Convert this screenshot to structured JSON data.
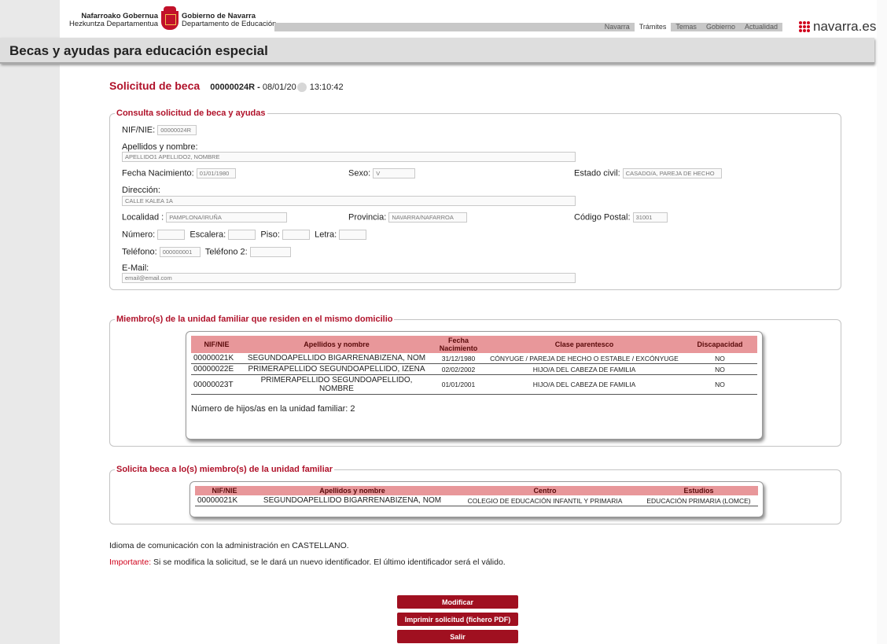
{
  "header": {
    "logo_line1_left": "Nafarroako Gobernua",
    "logo_line2_left": "Hezkuntza Departamentua",
    "logo_line1_right": "Gobierno de Navarra",
    "logo_line2_right": "Departamento de Educación",
    "nav": [
      "Navarra",
      "Trámites",
      "Temas",
      "Gobierno",
      "Actualidad"
    ],
    "nav_active": "Trámites",
    "site_logo": "navarra.es"
  },
  "page_title": "Becas y ayudas para educación especial",
  "solicitud": {
    "label": "Solicitud de beca",
    "id": "00000024R -",
    "date": "08/01/20",
    "time": "13:10:42"
  },
  "consulta": {
    "legend": "Consulta solicitud de beca y ayudas",
    "nif_label": "NIF/NIE:",
    "nif_value": "00000024R",
    "nombre_label": "Apellidos y nombre:",
    "nombre_value": "APELLIDO1 APELLIDO2, NOMBRE",
    "fecha_label": "Fecha Nacimiento:",
    "fecha_value": "01/01/1980",
    "sexo_label": "Sexo:",
    "sexo_value": "V",
    "estado_label": "Estado civil:",
    "estado_value": "CASADO/A, PAREJA DE HECHO",
    "direccion_label": "Dirección:",
    "direccion_value": "CALLE KALEA 1A",
    "localidad_label": "Localidad :",
    "localidad_value": "PAMPLONA/IRUÑA",
    "provincia_label": "Provincia:",
    "provincia_value": "NAVARRA/NAFARROA",
    "cp_label": "Código Postal:",
    "cp_value": "31001",
    "numero_label": "Número:",
    "escalera_label": "Escalera:",
    "piso_label": "Piso:",
    "letra_label": "Letra:",
    "telefono_label": "Teléfono:",
    "telefono_value": "000000001",
    "telefono2_label": "Teléfono 2:",
    "email_label": "E-Mail:",
    "email_value": "email@email.com"
  },
  "miembros": {
    "legend": "Miembro(s) de la unidad familiar que residen en el mismo domicilio",
    "headers": [
      "NIF/NIE",
      "Apellidos y nombre",
      "Fecha Nacimiento",
      "Clase parentesco",
      "Discapacidad"
    ],
    "rows": [
      [
        "00000021K",
        "SEGUNDOAPELLIDO BIGARRENABIZENA, NOM",
        "31/12/1980",
        "CÓNYUGE / PAREJA DE HECHO O ESTABLE / EXCÓNYUGE",
        "NO"
      ],
      [
        "00000022E",
        "PRIMERAPELLIDO SEGUNDOAPELLIDO, IZENA",
        "02/02/2002",
        "HIJO/A DEL CABEZA DE FAMILIA",
        "NO"
      ],
      [
        "00000023T",
        "PRIMERAPELLIDO SEGUNDOAPELLIDO, NOMBRE",
        "01/01/2001",
        "HIJO/A DEL CABEZA DE FAMILIA",
        "NO"
      ]
    ],
    "hijos_label": "Número de hijos/as en la unidad familiar:",
    "hijos_value": "2"
  },
  "solicita": {
    "legend": "Solicita beca a lo(s) miembro(s) de la unidad familiar",
    "headers": [
      "NIF/NIE",
      "Apellidos y nombre",
      "Centro",
      "Estudios"
    ],
    "rows": [
      [
        "00000021K",
        "SEGUNDOAPELLIDO BIGARRENABIZENA, NOM",
        "COLEGIO DE EDUCACIÓN INFANTIL Y PRIMARIA",
        "EDUCACIÓN PRIMARIA (LOMCE)"
      ]
    ]
  },
  "idioma": "Idioma de comunicación con la administración en CASTELLANO.",
  "importante_label": "Importante:",
  "importante_text": " Si se modifica la solicitud, se le dará un nuevo identificador. El último identificador será el válido.",
  "buttons": {
    "modificar": "Modificar",
    "imprimir": "Imprimir solicitud (fichero PDF)",
    "salir": "Salir"
  }
}
